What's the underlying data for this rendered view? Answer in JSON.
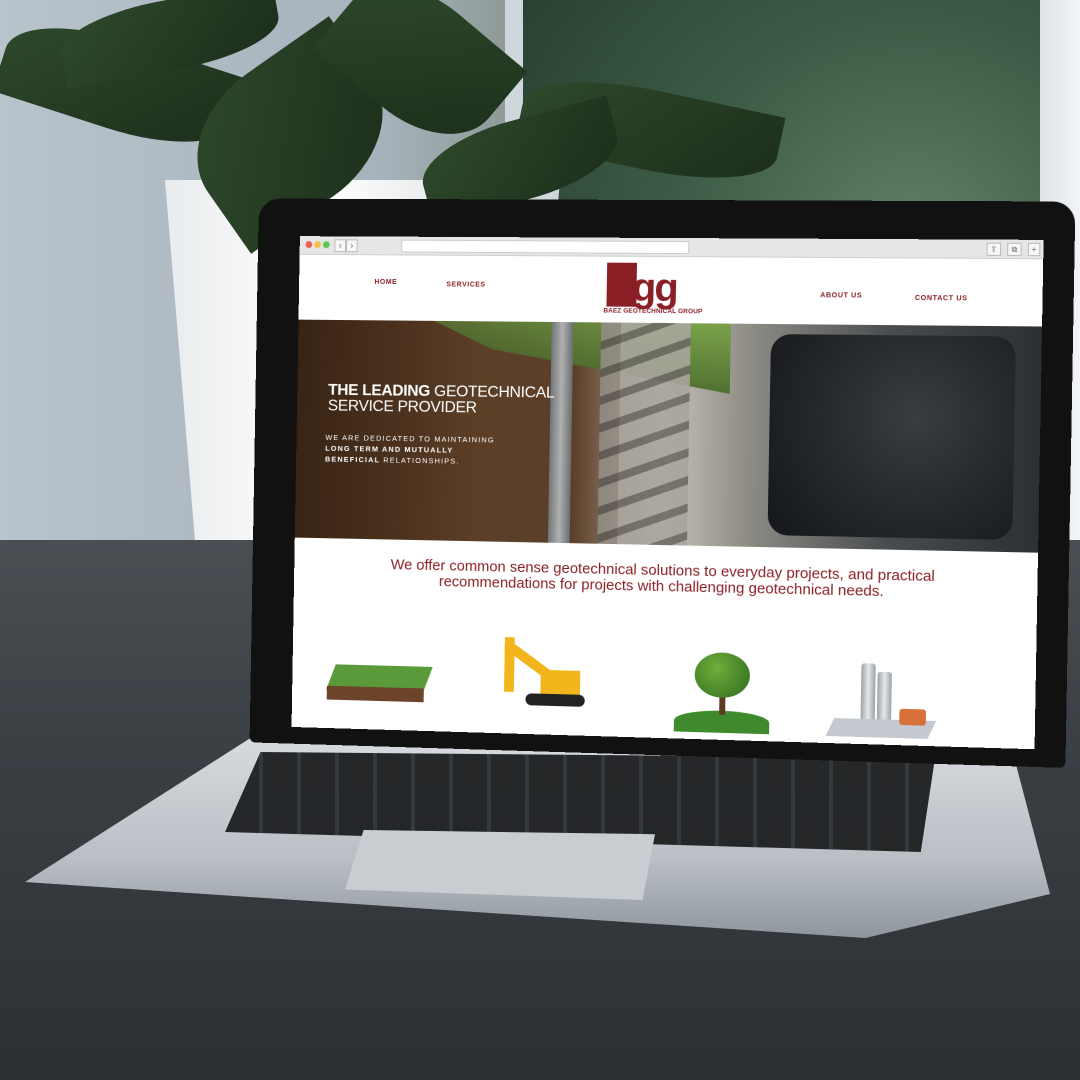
{
  "browser": {
    "back_icon": "‹",
    "forward_icon": "›",
    "share_icon": "⇪",
    "tabs_icon": "⧉",
    "add_tab_icon": "+"
  },
  "nav": {
    "home": "HOME",
    "services": "SERVICES",
    "about": "ABOUT US",
    "contact": "CONTACT US"
  },
  "logo": {
    "mark": "bgg",
    "name": "BAEZ GEOTECHNICAL GROUP"
  },
  "hero": {
    "title_bold": "THE LEADING",
    "title_rest": " GEOTECHNICAL",
    "title_line2": "SERVICE PROVIDER",
    "sub_part1": "WE ARE DEDICATED TO MAINTAINING",
    "sub_bold": "LONG TERM AND MUTUALLY BENEFICIAL",
    "sub_part2": " RELATIONSHIPS."
  },
  "intro": {
    "text": "We offer common sense geotechnical solutions to everyday projects, and practical recommendations for projects with challenging geotechnical needs."
  },
  "colors": {
    "brand": "#8a1f26"
  }
}
